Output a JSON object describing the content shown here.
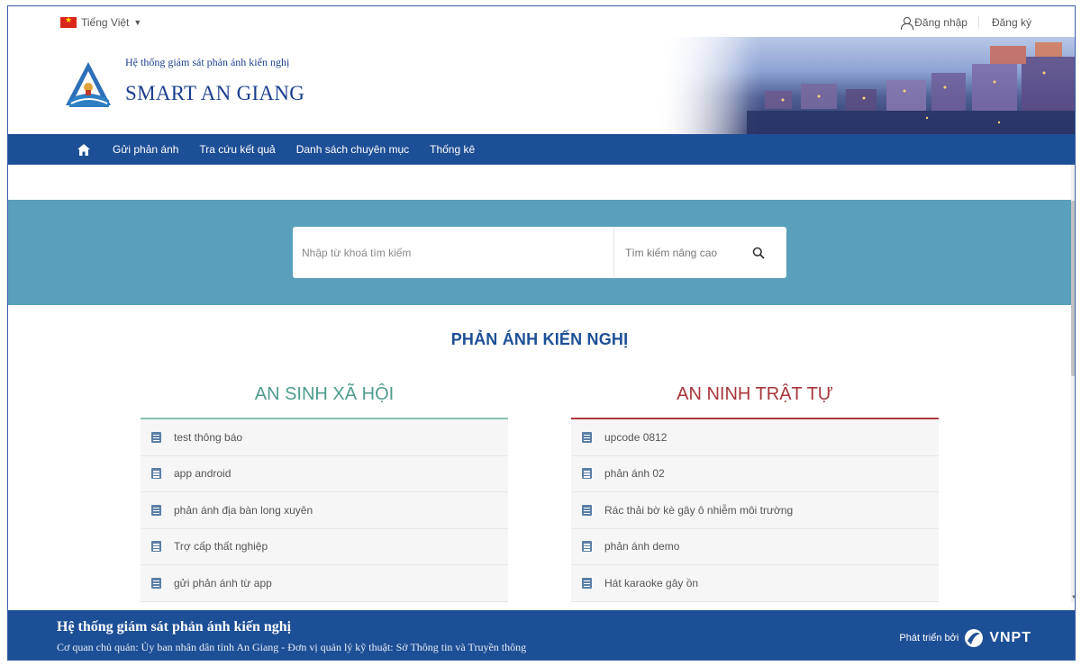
{
  "topbar": {
    "language": "Tiếng Việt",
    "login": "Đăng nhập",
    "register": "Đăng ký"
  },
  "header": {
    "subtitle": "Hệ thống giám sát phản ánh kiến nghị",
    "title": "SMART AN GIANG"
  },
  "nav": {
    "items": [
      {
        "label": "Gửi phản ánh"
      },
      {
        "label": "Tra cứu kết quả"
      },
      {
        "label": "Danh sách chuyên mục"
      },
      {
        "label": "Thống kê"
      }
    ]
  },
  "search": {
    "placeholder": "Nhập từ khoá tìm kiếm",
    "advanced": "Tìm kiếm nâng cao"
  },
  "main": {
    "section_title": "PHẢN ÁNH KIẾN NGHỊ",
    "left": {
      "title": "AN SINH XÃ HỘI",
      "items": [
        "test thông báo",
        "app android",
        "phản ánh địa bàn long xuyên",
        "Trợ cấp thất nghiệp",
        "gửi phản ánh từ app"
      ]
    },
    "right": {
      "title": "AN NINH TRẬT TỰ",
      "items": [
        "upcode 0812",
        "phản ánh 02",
        "Rác thải bờ kè gây ô nhiễm môi trường",
        "phản ánh demo",
        "Hát karaoke gây ồn"
      ]
    }
  },
  "footer": {
    "title": "Hệ thống giám sát phản ánh kiến nghị",
    "subtitle": "Cơ quan chủ quản: Ủy ban nhân dân tỉnh An Giang - Đơn vị quản lý kỹ thuật: Sở Thông tin và Truyền thông",
    "developed_by": "Phát triển bởi",
    "vendor": "VNPT"
  },
  "colors": {
    "nav_bg": "#1d4f96",
    "search_band": "#5a9fbc",
    "left_accent": "#4f9c8e",
    "right_accent": "#a9363a"
  },
  "icons": [
    "flag-vn-icon",
    "chevron-down-icon",
    "user-icon",
    "home-icon",
    "search-icon",
    "document-icon",
    "vnpt-logo-icon"
  ]
}
